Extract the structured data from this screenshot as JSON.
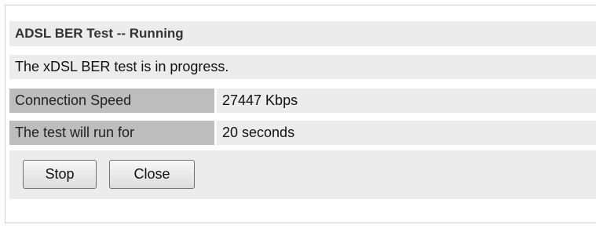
{
  "panel": {
    "title": "ADSL BER Test -- Running",
    "status_message": "The xDSL BER test is in progress."
  },
  "details": [
    {
      "label": "Connection Speed",
      "value": "27447 Kbps"
    },
    {
      "label": "The test will run for",
      "value": "20 seconds"
    }
  ],
  "buttons": {
    "stop_label": "Stop",
    "close_label": "Close"
  }
}
